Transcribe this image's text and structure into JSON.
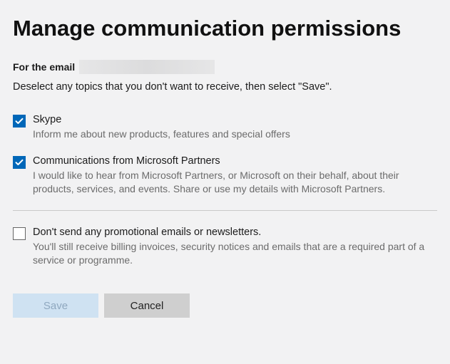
{
  "title": "Manage communication permissions",
  "email_prefix": "For the email",
  "email_value": "",
  "instruction": "Deselect any topics that you don't want to receive, then select \"Save\".",
  "topics": [
    {
      "checked": true,
      "label": "Skype",
      "desc": "Inform me about new products, features and special offers"
    },
    {
      "checked": true,
      "label": "Communications from Microsoft Partners",
      "desc": "I would like to hear from Microsoft Partners, or Microsoft on their behalf, about their products, services, and events. Share or use my details with Microsoft Partners."
    }
  ],
  "optout": {
    "checked": false,
    "label": "Don't send any promotional emails or newsletters.",
    "desc": "You'll still receive billing invoices, security notices and emails that are a required part of a service or programme."
  },
  "buttons": {
    "save": "Save",
    "cancel": "Cancel"
  },
  "colors": {
    "accent": "#0067b8",
    "save_disabled_bg": "#cfe2f2",
    "cancel_bg": "#cfcfcf"
  }
}
